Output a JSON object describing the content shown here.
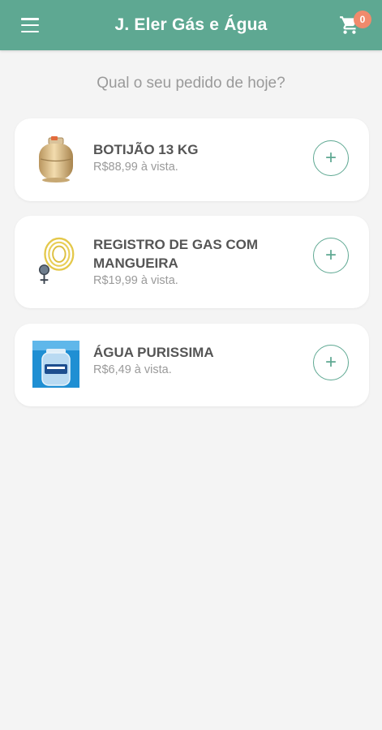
{
  "header": {
    "title": "J. Eler Gás e Água",
    "cart_count": "0",
    "menu_icon": "hamburger-menu-icon",
    "cart_icon": "shopping-cart-icon",
    "color": "#5ea892",
    "badge_color": "#f08a6c"
  },
  "subtitle": "Qual o seu pedido de hoje?",
  "products": [
    {
      "name": "BOTIJÃO 13 KG",
      "price": "R$88,99 à vista.",
      "add_label": "+",
      "image": "gas-cylinder-image"
    },
    {
      "name": "REGISTRO DE GAS COM MANGUEIRA",
      "price": "R$19,99 à vista.",
      "add_label": "+",
      "image": "gas-regulator-hose-image"
    },
    {
      "name": "ÁGUA PURISSIMA",
      "price": "R$6,49 à vista.",
      "add_label": "+",
      "image": "water-gallon-image"
    }
  ]
}
